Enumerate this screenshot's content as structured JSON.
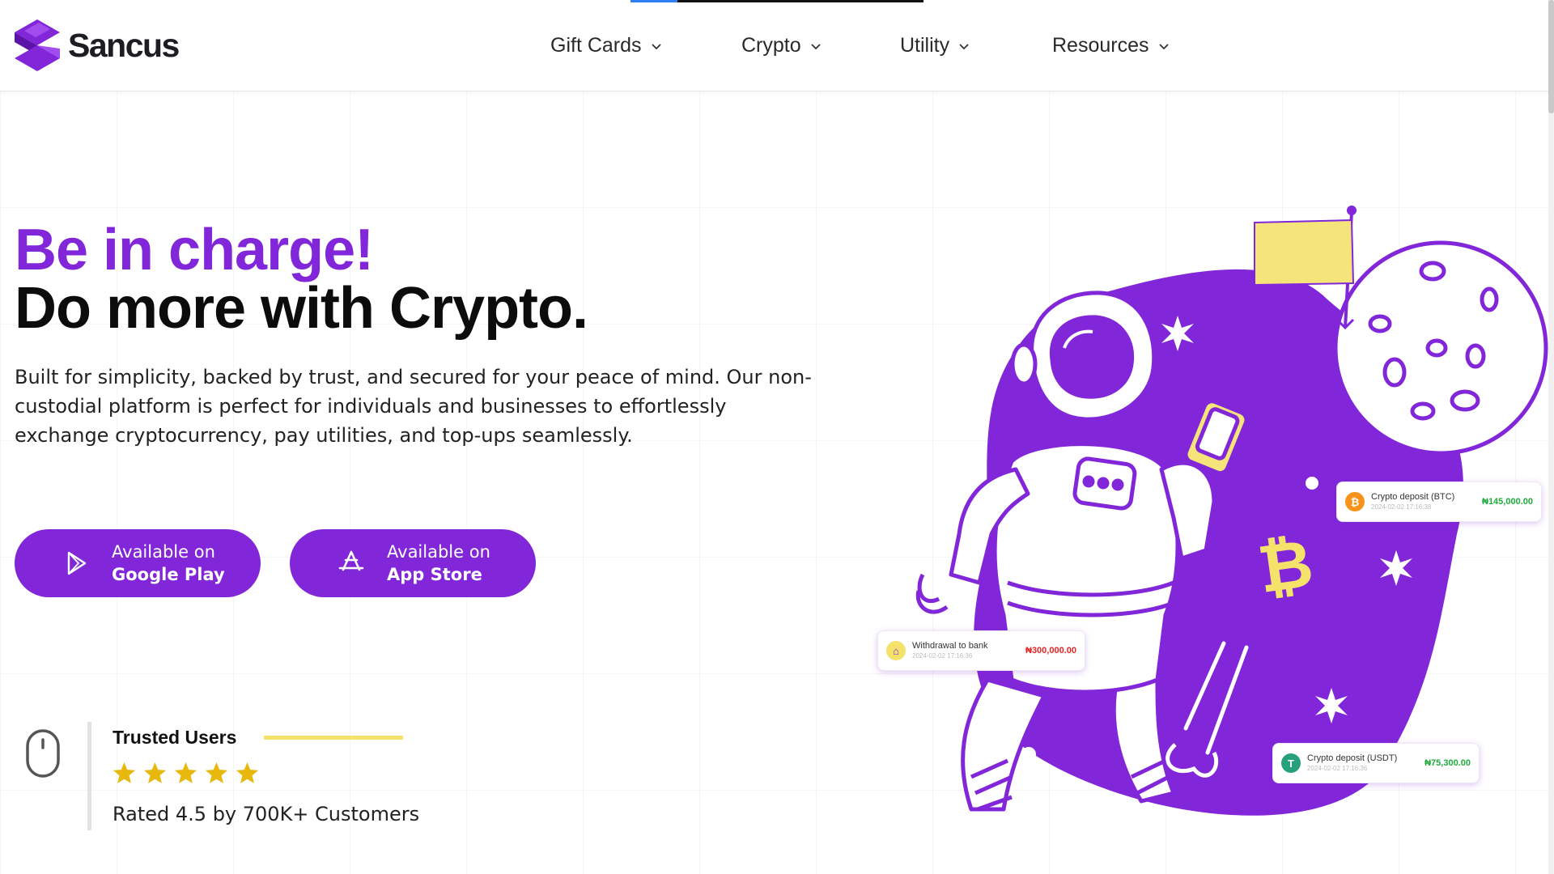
{
  "brand": {
    "name": "Sancus",
    "accent": "#8127d9",
    "logo_icon": "sancus-logo-icon"
  },
  "nav": {
    "items": [
      {
        "label": "Gift Cards",
        "icon": "chevron-down-icon"
      },
      {
        "label": "Crypto",
        "icon": "chevron-down-icon"
      },
      {
        "label": "Utility",
        "icon": "chevron-down-icon"
      },
      {
        "label": "Resources",
        "icon": "chevron-down-icon"
      }
    ]
  },
  "page_progress": 0.16,
  "hero": {
    "title_line1": "Be in charge!",
    "title_line2": "Do more with Crypto.",
    "description": "Built for simplicity, backed by trust, and secured for your peace of mind. Our non-custodial platform is perfect for individuals and businesses to effortlessly exchange cryptocurrency, pay utilities, and top-ups seamlessly."
  },
  "store_buttons": [
    {
      "sub": "Available on",
      "main": "Google Play",
      "icon": "google-play-icon"
    },
    {
      "sub": "Available on",
      "main": "App Store",
      "icon": "app-store-icon"
    }
  ],
  "trust": {
    "title": "Trusted Users",
    "stars": 5,
    "rating_text": "Rated 4.5 by 700K+ Customers",
    "icon": "mouse-scroll-icon"
  },
  "cards": [
    {
      "label": "Crypto deposit (BTC)",
      "date": "2024-02-02 17:16:38",
      "amount": "₦145,000.00",
      "amount_color": "#1faa3c",
      "icon": "bitcoin-icon",
      "icon_color": "#f7931a"
    },
    {
      "label": "Withdrawal to bank",
      "date": "2024-02-02 17:16:36",
      "amount": "₦300,000.00",
      "amount_color": "#e02424",
      "icon": "bank-icon",
      "icon_color": "#f5e26b"
    },
    {
      "label": "Crypto deposit (USDT)",
      "date": "2024-02-02 17:16:36",
      "amount": "₦75,300.00",
      "amount_color": "#1faa3c",
      "icon": "tether-icon",
      "icon_color": "#26a17b"
    }
  ]
}
